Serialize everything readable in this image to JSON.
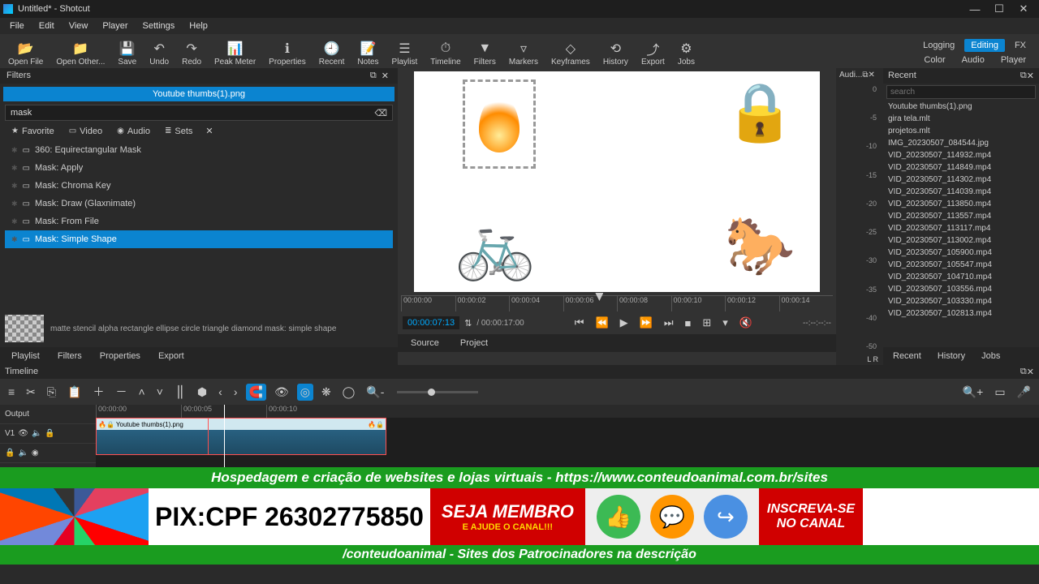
{
  "window": {
    "title": "Untitled* - Shotcut"
  },
  "menu": [
    "File",
    "Edit",
    "View",
    "Player",
    "Settings",
    "Help"
  ],
  "toolbar": [
    {
      "icon": "📂",
      "label": "Open File"
    },
    {
      "icon": "📁",
      "label": "Open Other..."
    },
    {
      "icon": "💾",
      "label": "Save"
    },
    {
      "icon": "↶",
      "label": "Undo"
    },
    {
      "icon": "↷",
      "label": "Redo"
    },
    {
      "icon": "📊",
      "label": "Peak Meter"
    },
    {
      "icon": "ℹ",
      "label": "Properties"
    },
    {
      "icon": "🕘",
      "label": "Recent"
    },
    {
      "icon": "📝",
      "label": "Notes"
    },
    {
      "icon": "☰",
      "label": "Playlist"
    },
    {
      "icon": "⏱",
      "label": "Timeline"
    },
    {
      "icon": "▼",
      "label": "Filters"
    },
    {
      "icon": "▿",
      "label": "Markers"
    },
    {
      "icon": "◇",
      "label": "Keyframes"
    },
    {
      "icon": "⟲",
      "label": "History"
    },
    {
      "icon": "⤴",
      "label": "Export"
    },
    {
      "icon": "⚙",
      "label": "Jobs"
    }
  ],
  "modes": {
    "row1": [
      {
        "t": "Logging",
        "a": false
      },
      {
        "t": "Editing",
        "a": true
      },
      {
        "t": "FX",
        "a": false
      }
    ],
    "row2": [
      {
        "t": "Color",
        "a": false
      },
      {
        "t": "Audio",
        "a": false
      },
      {
        "t": "Player",
        "a": false
      }
    ]
  },
  "filters_panel": {
    "title": "Filters",
    "clip_name": "Youtube thumbs(1).png",
    "search": "mask",
    "cats": [
      {
        "icon": "★",
        "label": "Favorite"
      },
      {
        "icon": "▭",
        "label": "Video"
      },
      {
        "icon": "◉",
        "label": "Audio"
      },
      {
        "icon": "≣",
        "label": "Sets"
      }
    ],
    "items": [
      {
        "label": "360: Equirectangular Mask",
        "sel": false
      },
      {
        "label": "Mask: Apply",
        "sel": false
      },
      {
        "label": "Mask: Chroma Key",
        "sel": false
      },
      {
        "label": "Mask: Draw (Glaxnimate)",
        "sel": false
      },
      {
        "label": "Mask: From File",
        "sel": false
      },
      {
        "label": "Mask: Simple Shape",
        "sel": true
      }
    ],
    "desc": "matte stencil alpha rectangle ellipse circle triangle diamond mask: simple shape",
    "tabs": [
      "Playlist",
      "Filters",
      "Properties",
      "Export"
    ]
  },
  "player": {
    "ruler": [
      "00:00:00",
      "00:00:02",
      "00:00:04",
      "00:00:06",
      "00:00:08",
      "00:00:10",
      "00:00:12",
      "00:00:14"
    ],
    "timecode": "00:00:07:13",
    "duration": "/ 00:00:17:00",
    "dashes": "--:--:--:--",
    "tabs": [
      "Source",
      "Project"
    ]
  },
  "audio": {
    "title": "Audi...",
    "levels": [
      "0",
      "-5",
      "-10",
      "-15",
      "-20",
      "-25",
      "-30",
      "-35",
      "-40",
      "-50"
    ],
    "lr": "L   R"
  },
  "recent": {
    "title": "Recent",
    "placeholder": "search",
    "items": [
      "Youtube thumbs(1).png",
      "gira tela.mlt",
      "projetos.mlt",
      "IMG_20230507_084544.jpg",
      "VID_20230507_114932.mp4",
      "VID_20230507_114849.mp4",
      "VID_20230507_114302.mp4",
      "VID_20230507_114039.mp4",
      "VID_20230507_113850.mp4",
      "VID_20230507_113557.mp4",
      "VID_20230507_113117.mp4",
      "VID_20230507_113002.mp4",
      "VID_20230507_105900.mp4",
      "VID_20230507_105547.mp4",
      "VID_20230507_104710.mp4",
      "VID_20230507_103556.mp4",
      "VID_20230507_103330.mp4",
      "VID_20230507_102813.mp4"
    ],
    "tabs": [
      "Recent",
      "History",
      "Jobs"
    ]
  },
  "timeline": {
    "title": "Timeline",
    "output": "Output",
    "v1": "V1",
    "ruler": [
      "00:00:00",
      "00:00:05",
      "00:00:10"
    ],
    "clip_label": "Youtube thumbs(1).png"
  },
  "banner": {
    "top": "Hospedagem e criação de websites e lojas virtuais - https://www.conteudoanimal.com.br/sites",
    "pix": "PIX:CPF 26302775850",
    "membro1": "SEJA MEMBRO",
    "membro2": "E AJUDE O CANAL!!!",
    "sub1": "INSCREVA-SE",
    "sub2": "NO CANAL",
    "bot": "/conteudoanimal    -    Sites dos Patrocinadores na descrição"
  }
}
